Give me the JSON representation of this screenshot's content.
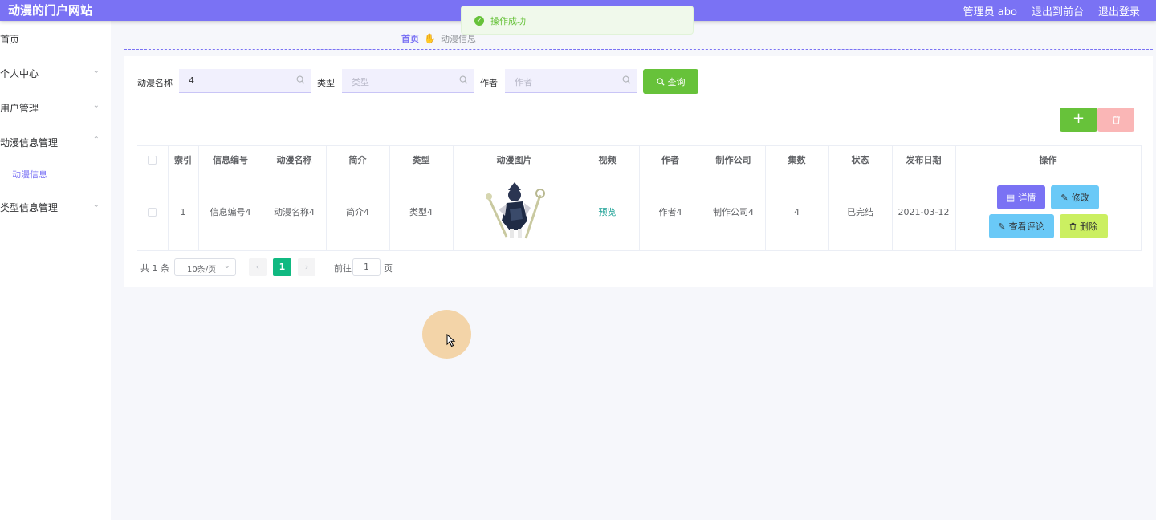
{
  "header": {
    "site_title": "动漫的门户网站",
    "user": "管理员 abo",
    "to_front": "退出到前台",
    "logout": "退出登录",
    "color": "#7a72f4"
  },
  "sidebar": {
    "items": [
      {
        "label": "首页"
      },
      {
        "label": "个人中心",
        "arrow": "⌄"
      },
      {
        "label": "用户管理",
        "arrow": "⌄"
      },
      {
        "label": "动漫信息管理",
        "arrow": "⌃"
      },
      {
        "label": "动漫信息"
      },
      {
        "label": "类型信息管理",
        "arrow": "⌄"
      }
    ]
  },
  "toast": {
    "message": "操作成功",
    "color": "#67c23a"
  },
  "breadcrumb": {
    "home": "首页",
    "current": "动漫信息"
  },
  "search": {
    "name_label": "动漫名称",
    "name_value": "4",
    "type_label": "类型",
    "type_placeholder": "类型",
    "author_label": "作者",
    "author_placeholder": "作者",
    "query_label": "查询"
  },
  "actions": {
    "add": "+"
  },
  "table": {
    "columns": [
      "索引",
      "信息编号",
      "动漫名称",
      "简介",
      "类型",
      "动漫图片",
      "视频",
      "作者",
      "制作公司",
      "集数",
      "状态",
      "发布日期",
      "操作"
    ],
    "rows": [
      {
        "index": "1",
        "code": "信息编号4",
        "name": "动漫名称4",
        "intro": "简介4",
        "type": "类型4",
        "video": "预览",
        "author": "作者4",
        "company": "制作公司4",
        "episodes": "4",
        "status": "已完结",
        "date": "2021-03-12"
      }
    ],
    "ops": {
      "detail": "详情",
      "edit": "修改",
      "comments": "查看评论",
      "delete": "删除"
    }
  },
  "pagination": {
    "total": "共 1 条",
    "page_size": "10条/页",
    "current_page": "1",
    "goto_label": "前往",
    "goto_value": "1",
    "page_unit": "页"
  }
}
